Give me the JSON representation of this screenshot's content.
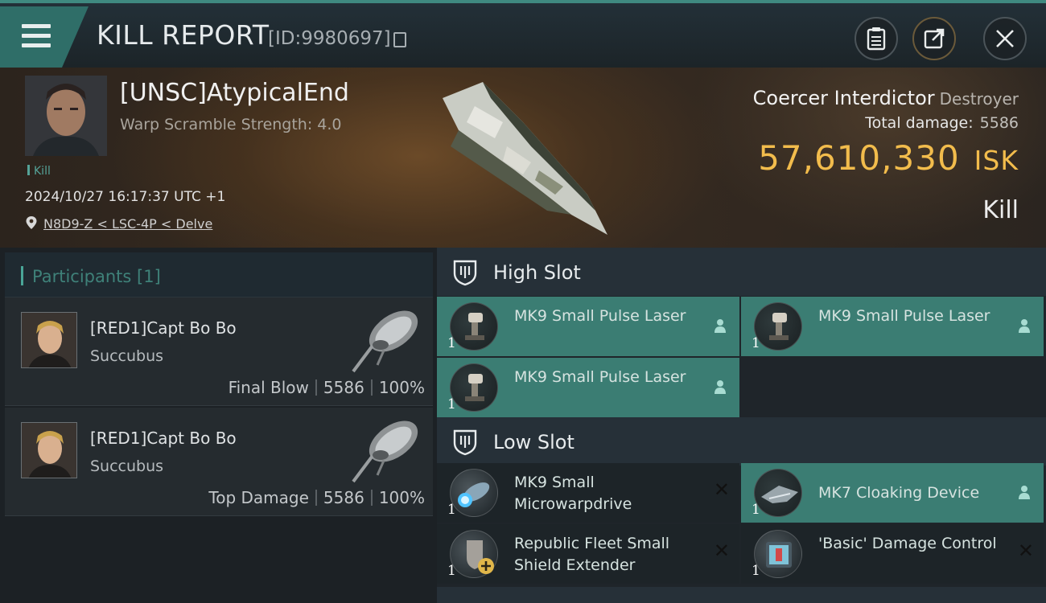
{
  "header": {
    "title": "KILL REPORT",
    "report_id": "[ID:9980697]"
  },
  "victim": {
    "name": "[UNSC]AtypicalEnd",
    "warp_scramble": "Warp Scramble Strength: 4.0",
    "tag": "Kill",
    "timestamp": "2024/10/27 16:17:37 UTC +1",
    "location": "N8D9-Z < LSC-4P < Delve",
    "ship_name": "Coercer Interdictor",
    "ship_class": "Destroyer",
    "total_damage_label": "Total damage:",
    "total_damage": "5586",
    "isk_value": "57,610,330",
    "isk_unit": "ISK",
    "result": "Kill"
  },
  "participants": {
    "label": "Participants",
    "count": "[1]",
    "list": [
      {
        "name": "[RED1]Capt Bo Bo",
        "ship": "Succubus",
        "role": "Final Blow",
        "damage": "5586",
        "percent": "100%"
      },
      {
        "name": "[RED1]Capt Bo Bo",
        "ship": "Succubus",
        "role": "Top Damage",
        "damage": "5586",
        "percent": "100%"
      }
    ]
  },
  "slots": {
    "high": {
      "label": "High Slot",
      "modules": [
        {
          "qty": "1",
          "name": "MK9 Small Pulse Laser",
          "state": "fitted"
        },
        {
          "qty": "1",
          "name": "MK9 Small Pulse Laser",
          "state": "fitted"
        },
        {
          "qty": "1",
          "name": "MK9 Small Pulse Laser",
          "state": "fitted"
        }
      ]
    },
    "low": {
      "label": "Low Slot",
      "modules": [
        {
          "qty": "1",
          "name": "MK9 Small Microwarpdrive",
          "state": "destroyed"
        },
        {
          "qty": "1",
          "name": "MK7 Cloaking Device",
          "state": "fitted"
        },
        {
          "qty": "1",
          "name": "Republic Fleet Small Shield Extender",
          "state": "destroyed"
        },
        {
          "qty": "1",
          "name": "'Basic' Damage Control",
          "state": "destroyed"
        }
      ]
    }
  },
  "icons": {
    "menu": "menu-icon",
    "copy": "copy-icon",
    "notes": "clipboard-icon",
    "share": "share-icon",
    "close": "close-icon",
    "location": "location-pin-icon",
    "slot": "shield-slot-icon",
    "pilot": "pilot-icon"
  },
  "colors": {
    "accent": "#3b7d73",
    "isk": "#f2bc4c",
    "tag": "#55a398"
  }
}
